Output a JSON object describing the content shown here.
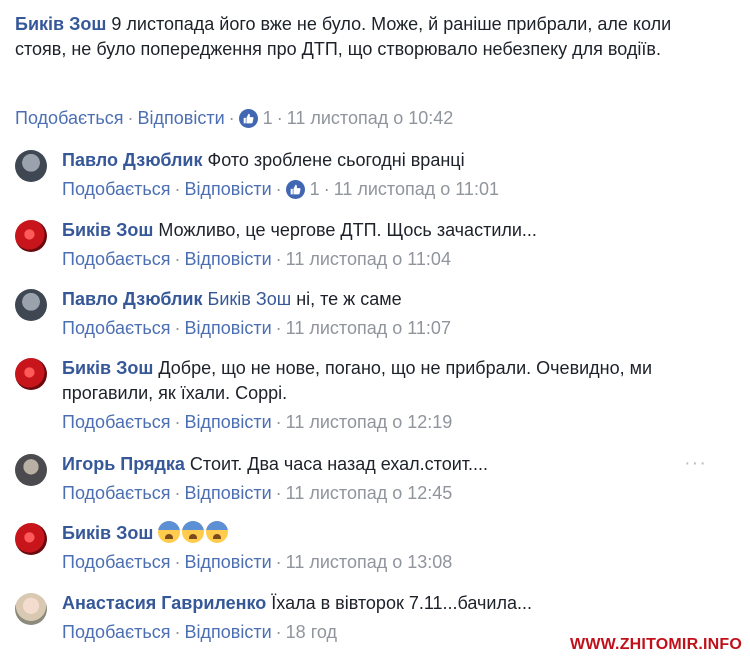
{
  "actions": {
    "like": "Подобається",
    "reply": "Відповісти",
    "separator": "·"
  },
  "top_comment": {
    "author": "Биків Зош",
    "text": "9 листопада його вже не було. Може, й раніше прибрали, але коли стояв, не було попередження про ДТП, що створювало небезпеку для водіїв.",
    "likes": "1",
    "time": "11 листопад о 10:42"
  },
  "replies": [
    {
      "author": "Павло Дзюблик",
      "text": "Фото зроблене сьогодні вранці",
      "likes": "1",
      "time": "11 листопад о 11:01"
    },
    {
      "author": "Биків Зош",
      "text": "Можливо, це чергове ДТП. Щось зачастили...",
      "time": "11 листопад о 11:04"
    },
    {
      "author": "Павло Дзюблик",
      "mention": "Биків Зош",
      "text": "ні, те ж саме",
      "time": "11 листопад о 11:07"
    },
    {
      "author": "Биків Зош",
      "text": "Добре, що не нове, погано, що не прибрали. Очевидно, ми прогавили, як їхали. Соррі.",
      "time": "11 листопад о 12:19"
    },
    {
      "author": "Игорь Прядка",
      "text": "Стоит. Два часа назад ехал.стоит....",
      "time": "11 листопад о 12:45"
    },
    {
      "author": "Биків Зош",
      "emoji_count": 3,
      "emoji": "anxious-face-with-sweat",
      "time": "11 листопад о 13:08"
    },
    {
      "author": "Анастасия Гавриленко",
      "text": "Їхала в вівторок 7.11...бачила...",
      "time": "18 год"
    }
  ],
  "more_options": "···",
  "watermark": "WWW.ZHITOMIR.INFO",
  "colors": {
    "author": "#365899",
    "link": "#4b6fb2",
    "meta": "#90949c",
    "text": "#1d2129",
    "like_badge": "#4267b2",
    "watermark": "#c0111b"
  }
}
